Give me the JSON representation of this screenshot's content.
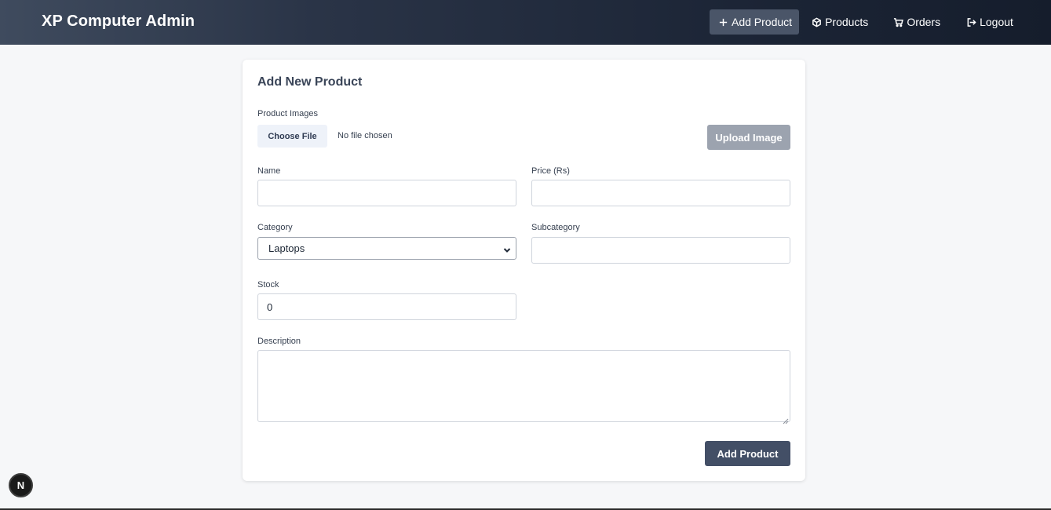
{
  "header": {
    "brand": "XP Computer Admin",
    "nav": [
      {
        "label": "Add Product",
        "icon": "plus-icon"
      },
      {
        "label": "Products",
        "icon": "box-icon"
      },
      {
        "label": "Orders",
        "icon": "cart-icon"
      },
      {
        "label": "Logout",
        "icon": "logout-icon"
      }
    ]
  },
  "form": {
    "title": "Add New Product",
    "images_label": "Product Images",
    "choose_file_label": "Choose File",
    "file_status": "No file chosen",
    "upload_label": "Upload Image",
    "name_label": "Name",
    "name_value": "",
    "price_label": "Price (Rs)",
    "price_value": "",
    "category_label": "Category",
    "category_value": "Laptops",
    "subcategory_label": "Subcategory",
    "subcategory_value": "",
    "stock_label": "Stock",
    "stock_value": "0",
    "description_label": "Description",
    "description_value": "",
    "submit_label": "Add Product"
  },
  "badge": {
    "letter": "N"
  },
  "colors": {
    "header_dark": "#1c2536",
    "active_nav": "#4a5568",
    "upload_disabled": "#9ca3af",
    "submit": "#434f66",
    "page_bg": "#f6f7f9"
  }
}
